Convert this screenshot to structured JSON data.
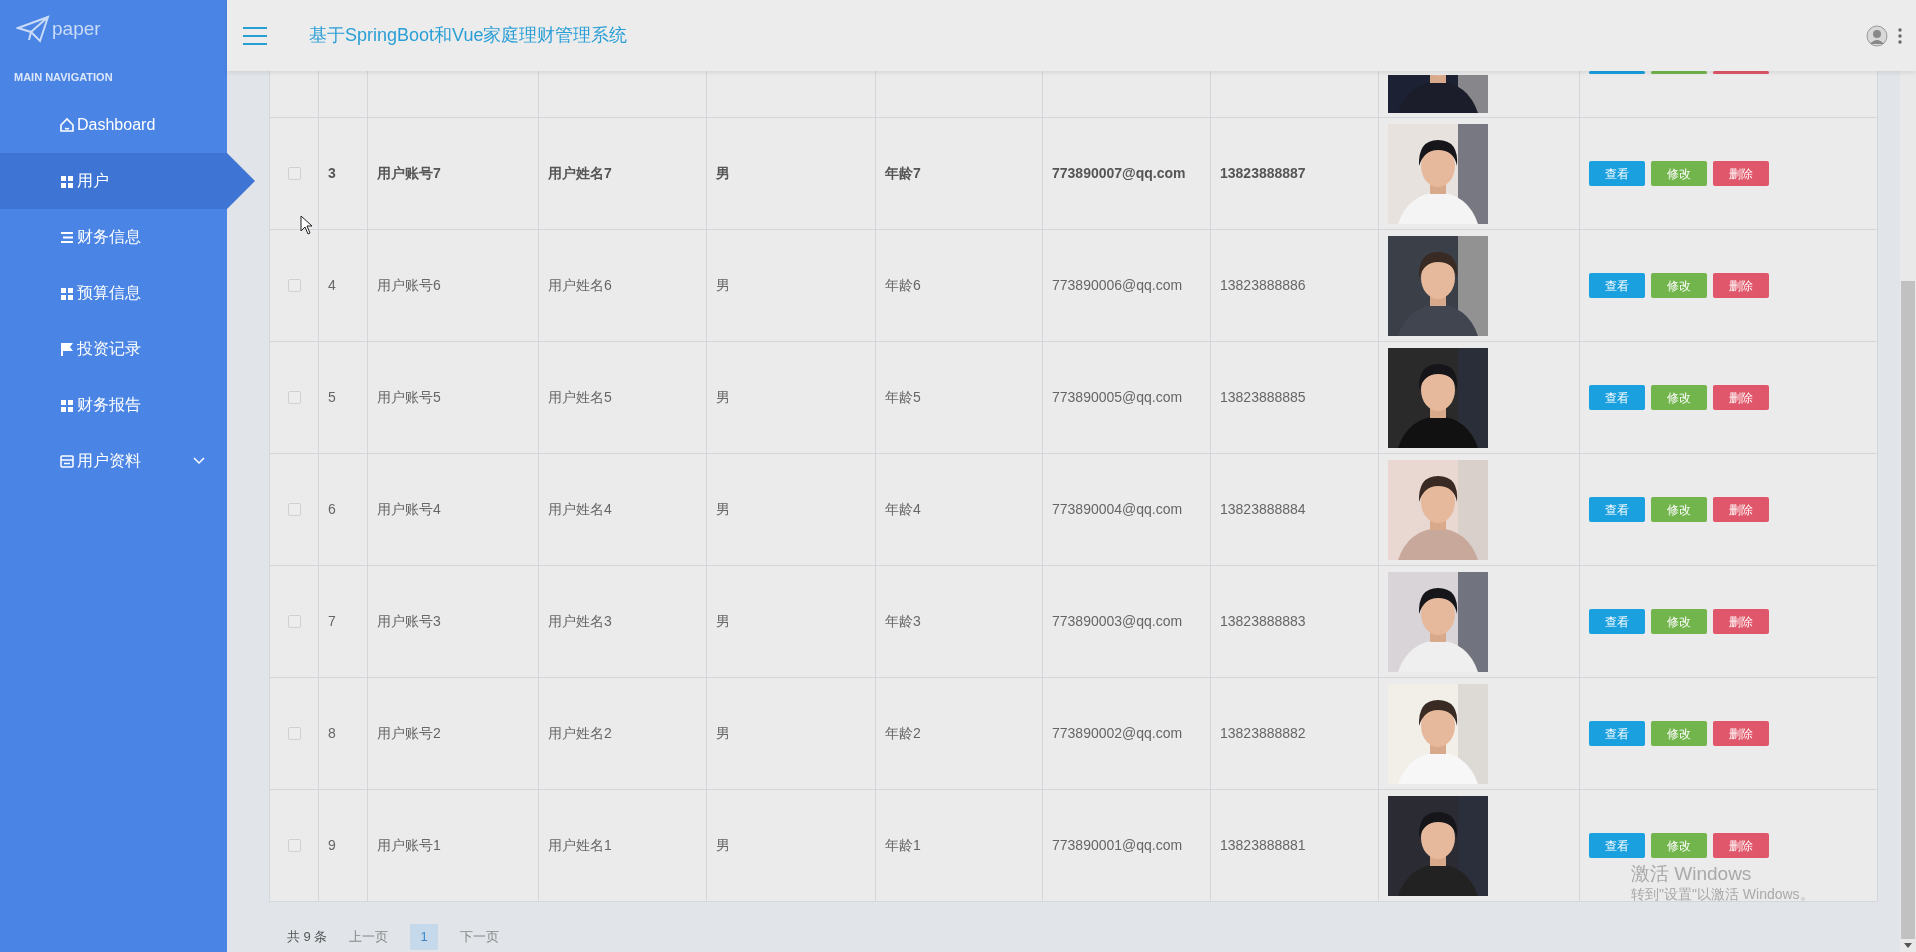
{
  "sidebar": {
    "logo": "paper",
    "section": "MAIN NAVIGATION",
    "items": [
      {
        "label": "Dashboard",
        "kind": "home",
        "selected": false
      },
      {
        "label": "用户",
        "kind": "grid",
        "selected": true
      },
      {
        "label": "财务信息",
        "kind": "list",
        "selected": false
      },
      {
        "label": "预算信息",
        "kind": "grid",
        "selected": false
      },
      {
        "label": "投资记录",
        "kind": "flag",
        "selected": false
      },
      {
        "label": "财务报告",
        "kind": "grid",
        "selected": false
      },
      {
        "label": "用户资料",
        "kind": "card",
        "selected": false,
        "expandable": true
      }
    ]
  },
  "header": {
    "title": "基于SpringBoot和Vue家庭理财管理系统"
  },
  "table": {
    "rows": [
      {
        "kind": "partial"
      },
      {
        "kind": "full",
        "checked": false,
        "selected": true,
        "index": "3",
        "account": "用户账号7",
        "name": "用户姓名7",
        "gender": "男",
        "age": "年龄7",
        "email": "773890007@qq.com",
        "phone": "13823888887",
        "buttons": [
          "查看",
          "修改",
          "删除"
        ]
      },
      {
        "kind": "full",
        "checked": false,
        "selected": false,
        "index": "4",
        "account": "用户账号6",
        "name": "用户姓名6",
        "gender": "男",
        "age": "年龄6",
        "email": "773890006@qq.com",
        "phone": "13823888886",
        "buttons": [
          "查看",
          "修改",
          "删除"
        ]
      },
      {
        "kind": "full",
        "checked": false,
        "selected": false,
        "index": "5",
        "account": "用户账号5",
        "name": "用户姓名5",
        "gender": "男",
        "age": "年龄5",
        "email": "773890005@qq.com",
        "phone": "13823888885",
        "buttons": [
          "查看",
          "修改",
          "删除"
        ]
      },
      {
        "kind": "full",
        "checked": false,
        "selected": false,
        "index": "6",
        "account": "用户账号4",
        "name": "用户姓名4",
        "gender": "男",
        "age": "年龄4",
        "email": "773890004@qq.com",
        "phone": "13823888884",
        "buttons": [
          "查看",
          "修改",
          "删除"
        ]
      },
      {
        "kind": "full",
        "checked": false,
        "selected": false,
        "index": "7",
        "account": "用户账号3",
        "name": "用户姓名3",
        "gender": "男",
        "age": "年龄3",
        "email": "773890003@qq.com",
        "phone": "13823888883",
        "buttons": [
          "查看",
          "修改",
          "删除"
        ]
      },
      {
        "kind": "full",
        "checked": false,
        "selected": false,
        "index": "8",
        "account": "用户账号2",
        "name": "用户姓名2",
        "gender": "男",
        "age": "年龄2",
        "email": "773890002@qq.com",
        "phone": "13823888882",
        "buttons": [
          "查看",
          "修改",
          "删除"
        ]
      },
      {
        "kind": "full",
        "checked": false,
        "selected": false,
        "index": "9",
        "account": "用户账号1",
        "name": "用户姓名1",
        "gender": "男",
        "age": "年龄1",
        "email": "773890001@qq.com",
        "phone": "13823888881",
        "buttons": [
          "查看",
          "修改",
          "删除"
        ]
      }
    ]
  },
  "pagination": {
    "total": "共 9 条",
    "prev": "上一页",
    "pages": [
      {
        "label": "1",
        "selected": true
      }
    ],
    "next": "下一页"
  },
  "os_notice": {
    "title": "激活 Windows",
    "text": "转到\"设置\"以激活 Windows。"
  }
}
